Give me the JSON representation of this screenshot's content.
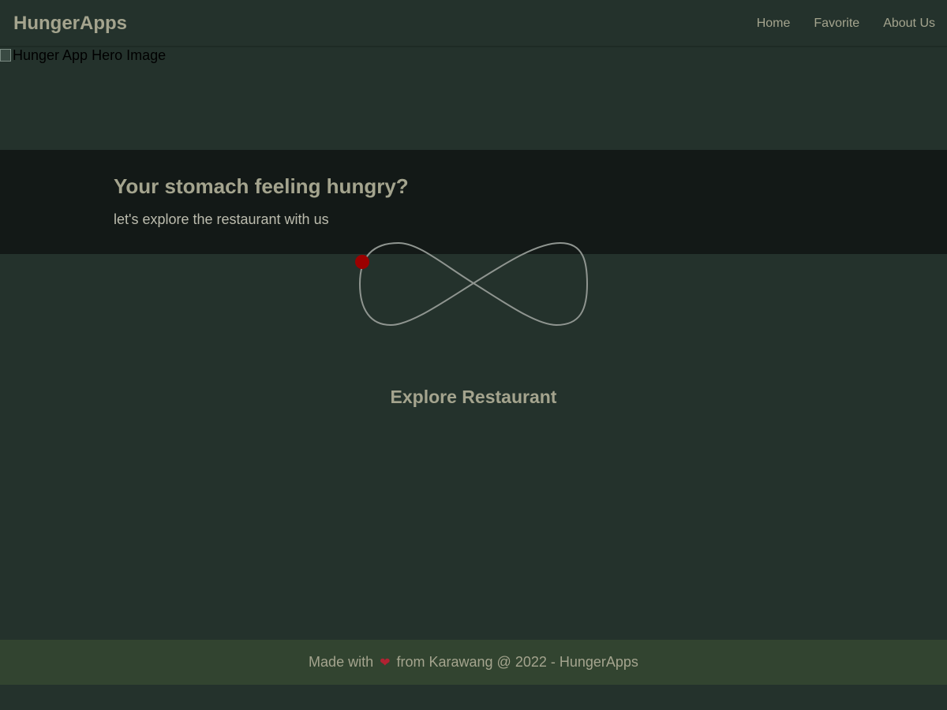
{
  "app_bar": {
    "brand": "HungerApps",
    "nav": [
      {
        "label": "Home"
      },
      {
        "label": "Favorite"
      },
      {
        "label": "About Us"
      }
    ]
  },
  "hero": {
    "image_alt": "Hunger App Hero Image",
    "title": "Your stomach feeling hungry?",
    "tagline": "let's explore the restaurant with us"
  },
  "loader": {
    "icon": "infinity-loader-icon",
    "dot_color": "#9b0000",
    "path_color": "#8f9590"
  },
  "main": {
    "section_title": "Explore Restaurant"
  },
  "footer": {
    "text_before": "Made with",
    "heart_icon": "heart-icon",
    "text_after": "from Karawang @ 2022 - HungerApps"
  },
  "colors": {
    "background": "#24322c",
    "hero_caption_bg": "#131917",
    "footer_bg": "#324430",
    "text_primary": "#a4a48e"
  }
}
